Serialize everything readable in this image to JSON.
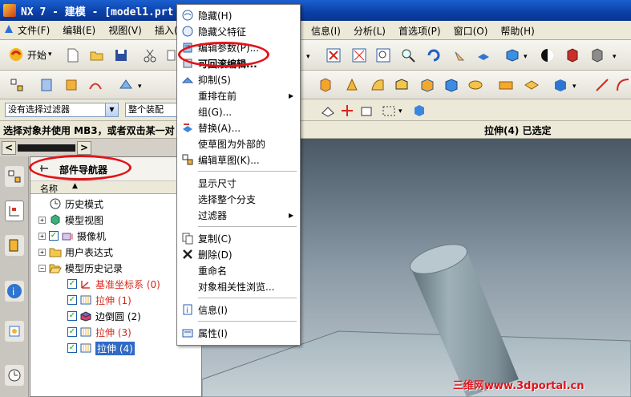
{
  "window": {
    "title": "NX 7 - 建模 - [model1.prt",
    "menus": [
      "文件(F)",
      "编辑(E)",
      "视图(V)",
      "插入(S)"
    ],
    "menus_right": [
      "信息(I)",
      "分析(L)",
      "首选项(P)",
      "窗口(O)",
      "帮助(H)"
    ]
  },
  "toolbar": {
    "start_label": "开始",
    "start_dropdown": "▾"
  },
  "filters": {
    "selection_filter": "没有选择过滤器",
    "assembly_scope": "整个装配"
  },
  "status": {
    "prompt": "选择对象并使用 MB3，或者双击某一对",
    "selection": "拉伸(4) 已选定"
  },
  "nav_tabs": {
    "prev": "<",
    "next": ">"
  },
  "navigator": {
    "title": "部件导航器",
    "column_name": "名称",
    "items": [
      {
        "label": "历史模式",
        "expander": "",
        "checked": false,
        "red": false,
        "selected": false,
        "icon": "clock-icon"
      },
      {
        "label": "模型视图",
        "expander": "+",
        "checked": false,
        "red": false,
        "selected": false,
        "icon": "model-views-icon"
      },
      {
        "label": "摄像机",
        "expander": "+",
        "checked": true,
        "red": false,
        "selected": false,
        "icon": "camera-icon"
      },
      {
        "label": "用户表达式",
        "expander": "+",
        "checked": false,
        "red": false,
        "selected": false,
        "icon": "folder-icon"
      },
      {
        "label": "模型历史记录",
        "expander": "−",
        "checked": false,
        "red": false,
        "selected": false,
        "icon": "folder-open-icon"
      },
      {
        "label": "基准坐标系 (0)",
        "expander": "",
        "checked": true,
        "red": true,
        "selected": false,
        "icon": "datum-csys-icon"
      },
      {
        "label": "拉伸 (1)",
        "expander": "",
        "checked": true,
        "red": true,
        "selected": false,
        "icon": "extrude-icon"
      },
      {
        "label": "边倒圆 (2)",
        "expander": "",
        "checked": true,
        "red": false,
        "selected": false,
        "icon": "edge-blend-icon"
      },
      {
        "label": "拉伸 (3)",
        "expander": "",
        "checked": true,
        "red": true,
        "selected": false,
        "icon": "extrude-icon"
      },
      {
        "label": "拉伸 (4)",
        "expander": "",
        "checked": true,
        "red": false,
        "selected": true,
        "icon": "extrude-icon"
      }
    ]
  },
  "context_menu": {
    "items": [
      {
        "label": "隐藏(H)",
        "icon": "hide-icon"
      },
      {
        "label": "隐藏父特征",
        "icon": "hide-parent-icon"
      },
      {
        "label": "编辑参数(P)...",
        "icon": "edit-parameters-icon"
      },
      {
        "label": "可回滚编辑...",
        "icon": "rollback-edit-icon"
      },
      {
        "label": "抑制(S)",
        "icon": "suppress-icon"
      },
      {
        "label": "重排在前",
        "icon": "",
        "submenu": true
      },
      {
        "label": "组(G)...",
        "icon": ""
      },
      {
        "label": "替换(A)...",
        "icon": "replace-icon"
      },
      {
        "label": "使草图为外部的",
        "icon": ""
      },
      {
        "label": "编辑草图(K)...",
        "icon": "edit-sketch-icon"
      },
      {
        "label": "显示尺寸",
        "icon": ""
      },
      {
        "label": "选择整个分支",
        "icon": ""
      },
      {
        "label": "过滤器",
        "icon": "",
        "submenu": true
      },
      {
        "label": "复制(C)",
        "icon": "copy-icon"
      },
      {
        "label": "删除(D)",
        "icon": "delete-icon"
      },
      {
        "label": "重命名",
        "icon": ""
      },
      {
        "label": "对象相关性浏览...",
        "icon": ""
      },
      {
        "label": "信息(I)",
        "icon": "info-icon"
      },
      {
        "label": "属性(I)",
        "icon": "properties-icon"
      }
    ]
  },
  "watermark": "三维网www.3dportal.cn",
  "colors": {
    "annotation": "#e0141a",
    "selection": "#316ac5",
    "feature_red": "#d42a1a"
  }
}
